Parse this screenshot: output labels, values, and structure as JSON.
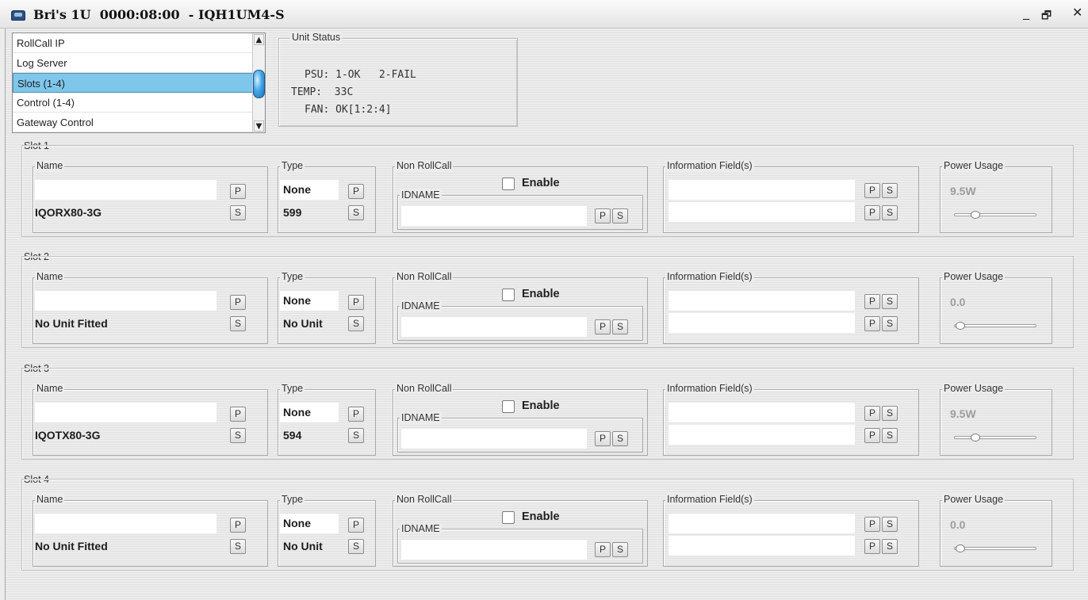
{
  "window": {
    "title": "Bri's 1U  0000:08:00  - IQH1UM4-S",
    "minimize_glyph": "_",
    "restore_glyph": "🗗",
    "close_glyph": "✕"
  },
  "nav": {
    "items": [
      {
        "label": "RollCall IP",
        "selected": false
      },
      {
        "label": "Log Server",
        "selected": false
      },
      {
        "label": "Slots (1-4)",
        "selected": true
      },
      {
        "label": "Control (1-4)",
        "selected": false
      },
      {
        "label": "Gateway Control",
        "selected": false
      }
    ],
    "scroll_up_glyph": "▲",
    "scroll_down_glyph": "▼"
  },
  "unit_status": {
    "label": "Unit Status",
    "psu": "PSU: 1-OK   2-FAIL",
    "temp": "TEMP:  33C",
    "fan": "FAN: OK[1:2:4]"
  },
  "labels": {
    "name": "Name",
    "type": "Type",
    "non_rollcall": "Non RollCall",
    "enable": "Enable",
    "idname": "IDNAME",
    "info": "Information Field(s)",
    "power": "Power Usage",
    "p": "P",
    "s": "S"
  },
  "slots": [
    {
      "label": "Slot 1",
      "name": "IQORX80-3G",
      "type_top": "None",
      "type_bottom": "599",
      "power": "9.5W",
      "power_level": 0.25
    },
    {
      "label": "Slot 2",
      "name": "No Unit Fitted",
      "type_top": "None",
      "type_bottom": "No Unit",
      "power": "0.0",
      "power_level": 0.0
    },
    {
      "label": "Slot 3",
      "name": "IQOTX80-3G",
      "type_top": "None",
      "type_bottom": "594",
      "power": "9.5W",
      "power_level": 0.25
    },
    {
      "label": "Slot 4",
      "name": "No Unit Fitted",
      "type_top": "None",
      "type_bottom": "No Unit",
      "power": "0.0",
      "power_level": 0.0
    }
  ]
}
